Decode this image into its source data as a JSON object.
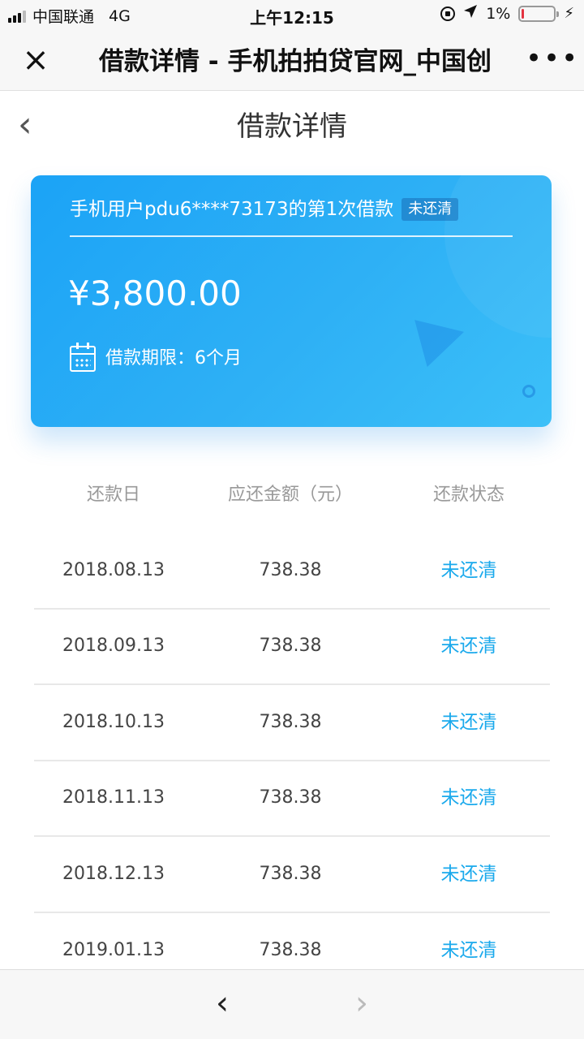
{
  "status_bar": {
    "carrier": "中国联通",
    "network": "4G",
    "time": "上午12:15",
    "battery": "1%",
    "battery_level": 0.03,
    "battery_color": "#e3323f"
  },
  "browser": {
    "close_icon": "×",
    "title": "借款详情 - 手机拍拍贷官网_中国创",
    "more_icon": "•••"
  },
  "header": {
    "back_icon": "‹",
    "title": "借款详情"
  },
  "loan_card": {
    "user_text": "手机用户pdu6****73173的第1次借款",
    "badge": "未还清",
    "amount": "¥3,800.00",
    "term_label": "借款期限：6个月"
  },
  "table": {
    "headers": [
      "还款日",
      "应还金额（元）",
      "还款状态"
    ],
    "rows": [
      {
        "date": "2018.08.13",
        "amount": "738.38",
        "status": "未还清"
      },
      {
        "date": "2018.09.13",
        "amount": "738.38",
        "status": "未还清"
      },
      {
        "date": "2018.10.13",
        "amount": "738.38",
        "status": "未还清"
      },
      {
        "date": "2018.11.13",
        "amount": "738.38",
        "status": "未还清"
      },
      {
        "date": "2018.12.13",
        "amount": "738.38",
        "status": "未还清"
      },
      {
        "date": "2019.01.13",
        "amount": "738.38",
        "status": "未还清"
      }
    ]
  },
  "bottom_nav": {
    "back_icon": "‹",
    "forward_icon": "›"
  },
  "colors": {
    "accent": "#1aa9ec",
    "card_gradient_start": "#1ba3f6",
    "card_gradient_end": "#3cc0f8"
  }
}
